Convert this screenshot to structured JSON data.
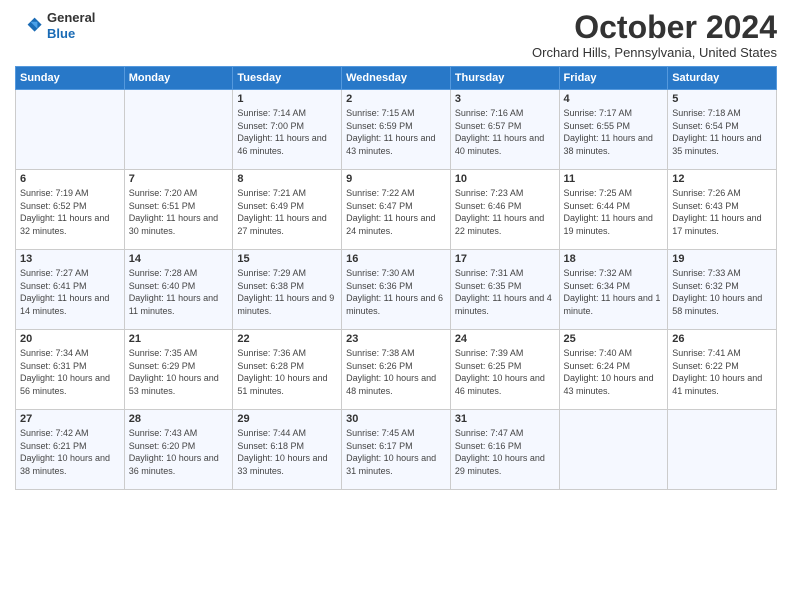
{
  "header": {
    "logo_line1": "General",
    "logo_line2": "Blue",
    "month_title": "October 2024",
    "location": "Orchard Hills, Pennsylvania, United States"
  },
  "weekdays": [
    "Sunday",
    "Monday",
    "Tuesday",
    "Wednesday",
    "Thursday",
    "Friday",
    "Saturday"
  ],
  "weeks": [
    [
      {
        "day": "",
        "info": ""
      },
      {
        "day": "",
        "info": ""
      },
      {
        "day": "1",
        "info": "Sunrise: 7:14 AM\nSunset: 7:00 PM\nDaylight: 11 hours\nand 46 minutes."
      },
      {
        "day": "2",
        "info": "Sunrise: 7:15 AM\nSunset: 6:59 PM\nDaylight: 11 hours\nand 43 minutes."
      },
      {
        "day": "3",
        "info": "Sunrise: 7:16 AM\nSunset: 6:57 PM\nDaylight: 11 hours\nand 40 minutes."
      },
      {
        "day": "4",
        "info": "Sunrise: 7:17 AM\nSunset: 6:55 PM\nDaylight: 11 hours\nand 38 minutes."
      },
      {
        "day": "5",
        "info": "Sunrise: 7:18 AM\nSunset: 6:54 PM\nDaylight: 11 hours\nand 35 minutes."
      }
    ],
    [
      {
        "day": "6",
        "info": "Sunrise: 7:19 AM\nSunset: 6:52 PM\nDaylight: 11 hours\nand 32 minutes."
      },
      {
        "day": "7",
        "info": "Sunrise: 7:20 AM\nSunset: 6:51 PM\nDaylight: 11 hours\nand 30 minutes."
      },
      {
        "day": "8",
        "info": "Sunrise: 7:21 AM\nSunset: 6:49 PM\nDaylight: 11 hours\nand 27 minutes."
      },
      {
        "day": "9",
        "info": "Sunrise: 7:22 AM\nSunset: 6:47 PM\nDaylight: 11 hours\nand 24 minutes."
      },
      {
        "day": "10",
        "info": "Sunrise: 7:23 AM\nSunset: 6:46 PM\nDaylight: 11 hours\nand 22 minutes."
      },
      {
        "day": "11",
        "info": "Sunrise: 7:25 AM\nSunset: 6:44 PM\nDaylight: 11 hours\nand 19 minutes."
      },
      {
        "day": "12",
        "info": "Sunrise: 7:26 AM\nSunset: 6:43 PM\nDaylight: 11 hours\nand 17 minutes."
      }
    ],
    [
      {
        "day": "13",
        "info": "Sunrise: 7:27 AM\nSunset: 6:41 PM\nDaylight: 11 hours\nand 14 minutes."
      },
      {
        "day": "14",
        "info": "Sunrise: 7:28 AM\nSunset: 6:40 PM\nDaylight: 11 hours\nand 11 minutes."
      },
      {
        "day": "15",
        "info": "Sunrise: 7:29 AM\nSunset: 6:38 PM\nDaylight: 11 hours\nand 9 minutes."
      },
      {
        "day": "16",
        "info": "Sunrise: 7:30 AM\nSunset: 6:36 PM\nDaylight: 11 hours\nand 6 minutes."
      },
      {
        "day": "17",
        "info": "Sunrise: 7:31 AM\nSunset: 6:35 PM\nDaylight: 11 hours\nand 4 minutes."
      },
      {
        "day": "18",
        "info": "Sunrise: 7:32 AM\nSunset: 6:34 PM\nDaylight: 11 hours\nand 1 minute."
      },
      {
        "day": "19",
        "info": "Sunrise: 7:33 AM\nSunset: 6:32 PM\nDaylight: 10 hours\nand 58 minutes."
      }
    ],
    [
      {
        "day": "20",
        "info": "Sunrise: 7:34 AM\nSunset: 6:31 PM\nDaylight: 10 hours\nand 56 minutes."
      },
      {
        "day": "21",
        "info": "Sunrise: 7:35 AM\nSunset: 6:29 PM\nDaylight: 10 hours\nand 53 minutes."
      },
      {
        "day": "22",
        "info": "Sunrise: 7:36 AM\nSunset: 6:28 PM\nDaylight: 10 hours\nand 51 minutes."
      },
      {
        "day": "23",
        "info": "Sunrise: 7:38 AM\nSunset: 6:26 PM\nDaylight: 10 hours\nand 48 minutes."
      },
      {
        "day": "24",
        "info": "Sunrise: 7:39 AM\nSunset: 6:25 PM\nDaylight: 10 hours\nand 46 minutes."
      },
      {
        "day": "25",
        "info": "Sunrise: 7:40 AM\nSunset: 6:24 PM\nDaylight: 10 hours\nand 43 minutes."
      },
      {
        "day": "26",
        "info": "Sunrise: 7:41 AM\nSunset: 6:22 PM\nDaylight: 10 hours\nand 41 minutes."
      }
    ],
    [
      {
        "day": "27",
        "info": "Sunrise: 7:42 AM\nSunset: 6:21 PM\nDaylight: 10 hours\nand 38 minutes."
      },
      {
        "day": "28",
        "info": "Sunrise: 7:43 AM\nSunset: 6:20 PM\nDaylight: 10 hours\nand 36 minutes."
      },
      {
        "day": "29",
        "info": "Sunrise: 7:44 AM\nSunset: 6:18 PM\nDaylight: 10 hours\nand 33 minutes."
      },
      {
        "day": "30",
        "info": "Sunrise: 7:45 AM\nSunset: 6:17 PM\nDaylight: 10 hours\nand 31 minutes."
      },
      {
        "day": "31",
        "info": "Sunrise: 7:47 AM\nSunset: 6:16 PM\nDaylight: 10 hours\nand 29 minutes."
      },
      {
        "day": "",
        "info": ""
      },
      {
        "day": "",
        "info": ""
      }
    ]
  ]
}
